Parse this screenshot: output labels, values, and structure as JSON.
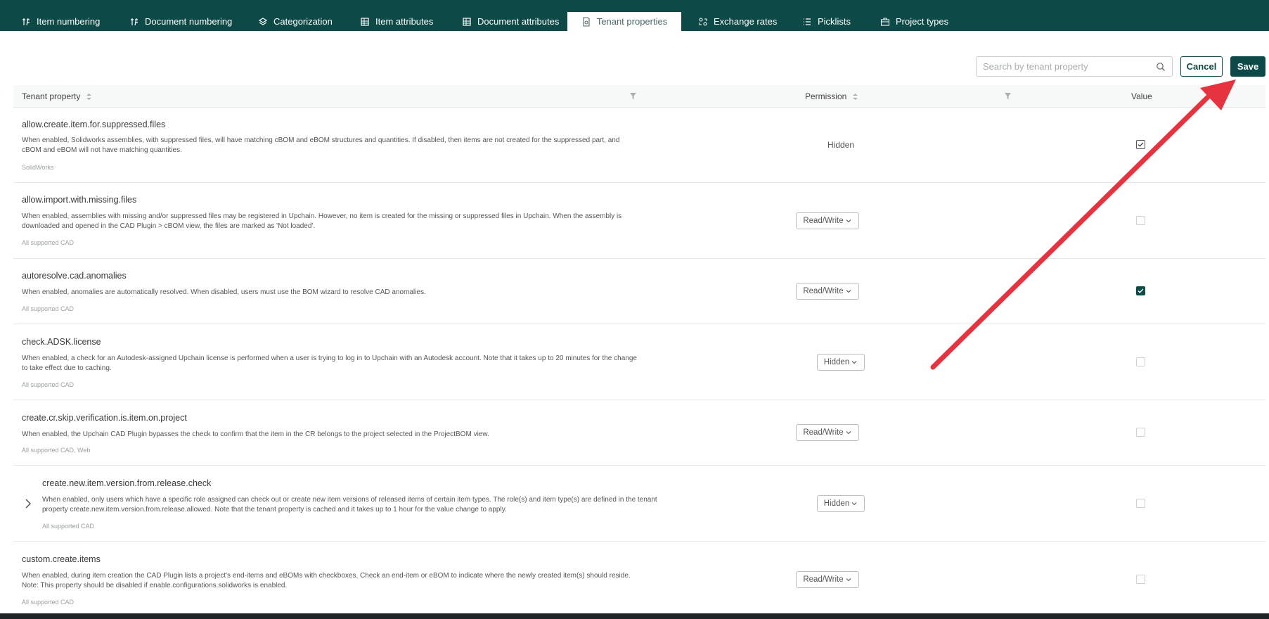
{
  "tabs": [
    {
      "label": "Item numbering",
      "icon": "numbering-icon"
    },
    {
      "label": "Document numbering",
      "icon": "numbering-icon"
    },
    {
      "label": "Categorization",
      "icon": "layers-icon"
    },
    {
      "label": "Item attributes",
      "icon": "table-icon"
    },
    {
      "label": "Document attributes",
      "icon": "table-icon"
    },
    {
      "label": "Tenant properties",
      "icon": "document-settings-icon",
      "active": true
    },
    {
      "label": "Exchange rates",
      "icon": "exchange-icon"
    },
    {
      "label": "Picklists",
      "icon": "list-icon"
    },
    {
      "label": "Project types",
      "icon": "briefcase-icon"
    }
  ],
  "search": {
    "placeholder": "Search by tenant property"
  },
  "actions": {
    "cancel_label": "Cancel",
    "save_label": "Save"
  },
  "table": {
    "headers": {
      "property": "Tenant property",
      "permission": "Permission",
      "value": "Value"
    },
    "rows": [
      {
        "name": "allow.create.item.for.suppressed.files",
        "description": "When enabled, Solidworks assemblies, with suppressed files, will have matching cBOM and eBOM structures and quantities. If disabled, then items are not created for the suppressed part, and cBOM and eBOM will not have matching quantities.",
        "cad": "SolidWorks",
        "permission": "Hidden",
        "permission_editable": false,
        "value": true
      },
      {
        "name": "allow.import.with.missing.files",
        "description": "When enabled, assemblies with missing and/or suppressed files may be registered in Upchain. However, no item is created for the missing or suppressed files in Upchain. When the assembly is downloaded and opened in the CAD Plugin > cBOM view, the files are marked as 'Not loaded'.",
        "cad": "All supported CAD",
        "permission": "Read/Write",
        "permission_editable": true,
        "value": false
      },
      {
        "name": "autoresolve.cad.anomalies",
        "description": "When enabled, anomalies are automatically resolved. When disabled, users must use the BOM wizard to resolve CAD anomalies.",
        "cad": "All supported CAD",
        "permission": "Read/Write",
        "permission_editable": true,
        "value": true
      },
      {
        "name": "check.ADSK.license",
        "description": "When enabled, a check for an Autodesk-assigned Upchain license is performed when a user is trying to log in to Upchain with an Autodesk account. Note that it takes up to 20 minutes for the change to take effect due to caching.",
        "cad": "All supported CAD",
        "permission": "Hidden",
        "permission_editable": true,
        "value": false
      },
      {
        "name": "create.cr.skip.verification.is.item.on.project",
        "description": "When enabled, the Upchain CAD Plugin bypasses the check to confirm that the item in the CR belongs to the project selected in the ProjectBOM view.",
        "cad": "All supported CAD, Web",
        "permission": "Read/Write",
        "permission_editable": true,
        "value": false
      },
      {
        "name": "create.new.item.version.from.release.check",
        "description": "When enabled, only users which have a specific role assigned can check out or create new item versions of released items of certain item types. The role(s) and item type(s) are defined in the tenant property create.new.item.version.from.release.allowed. Note that the tenant property is cached and it takes up to 1 hour for the value change to apply.",
        "cad": "All supported CAD",
        "permission": "Hidden",
        "permission_editable": true,
        "value": false,
        "expandable": true
      },
      {
        "name": "custom.create.items",
        "description": "When enabled, during item creation the CAD Plugin lists a project's end-items and eBOMs with checkboxes. Check an end-item or eBOM to indicate where the newly created item(s) should reside. Note: This property should be disabled if enable.configurations.solidworks is enabled.",
        "cad": "All supported CAD",
        "permission": "Read/Write",
        "permission_editable": true,
        "value": false
      }
    ]
  },
  "colors": {
    "brand": "#0d4a47",
    "arrow": "#e5343f"
  }
}
